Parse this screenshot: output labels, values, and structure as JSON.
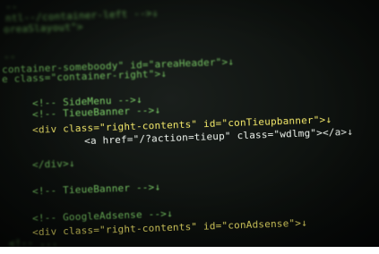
{
  "code_lines": [
    "--",
    "ntl--/container-left -->↓",
    "oreaSlayout\">",
    "--",
    "container-someboody\" id=\"areaHeader\">↓",
    "e class=\"container-right\">↓",
    "<!-- SideMenu -->↓",
    "<!-- TieueBanner -->↓",
    "<div class=\"right-contents\" id=\"conTieupbanner\">↓",
    "<a href=\"/?action=tieup\" class=\"wdlmg\"></a>↓",
    "</div>↓",
    "<!-- TieueBanner -->↓",
    "<!-- GoogleAdsense -->↓",
    "<div class=\"right-contents\" id=\"conAdsense\">↓",
    "<!-- ..."
  ],
  "colors": {
    "screen_background": "#0e120f",
    "tag_green": "#7fd36a",
    "attr_yellow": "#f4e96a",
    "string_white": "#eef4ee"
  }
}
